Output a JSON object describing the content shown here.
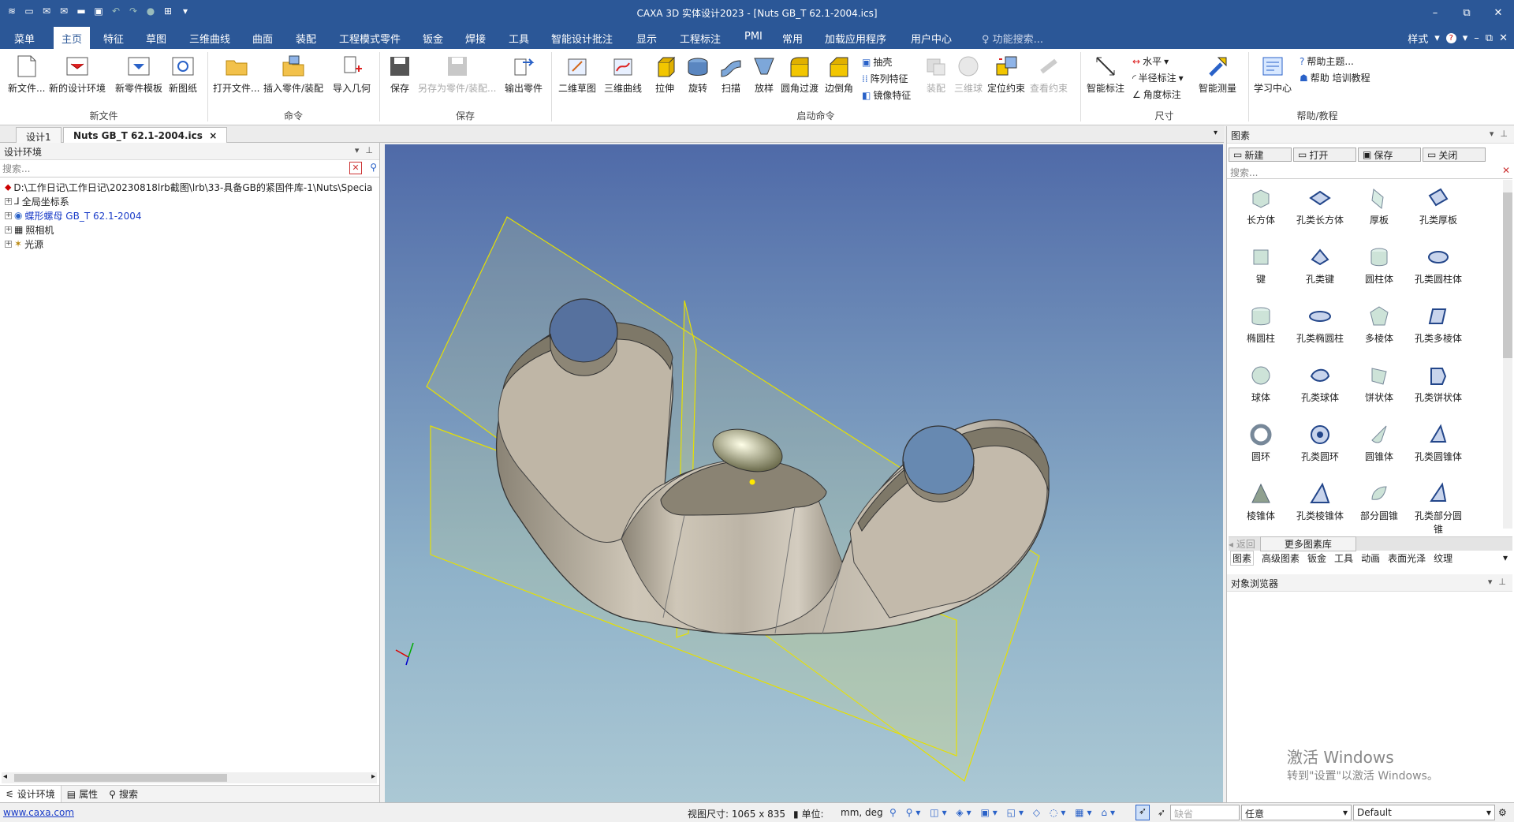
{
  "window": {
    "title": "CAXA 3D 实体设计2023 - [Nuts GB_T  62.1-2004.ics]",
    "min": "–",
    "restore": "⧉",
    "close": "✕"
  },
  "menubar": {
    "tabs": [
      "菜单",
      "主页",
      "特征",
      "草图",
      "三维曲线",
      "曲面",
      "装配",
      "工程模式零件",
      "钣金",
      "焊接",
      "工具",
      "智能设计批注",
      "显示",
      "工程标注",
      "PMI",
      "常用",
      "加载应用程序",
      "用户中心"
    ],
    "active": "主页",
    "search": "功能搜索...",
    "style": "样式"
  },
  "ribbon": {
    "new_file": {
      "buttons": [
        "新文件...",
        "新的设计环境",
        "新零件模板",
        "新图纸"
      ],
      "group": "新文件"
    },
    "command": {
      "buttons": [
        "打开文件...",
        "插入零件/装配",
        "导入几何"
      ],
      "group": "命令"
    },
    "save": {
      "buttons": [
        "保存",
        "另存为零件/装配...",
        "输出零件"
      ],
      "group": "保存"
    },
    "launch": {
      "buttons": [
        "二维草图",
        "三维曲线",
        "拉伸",
        "旋转",
        "扫描",
        "放样",
        "圆角过渡",
        "边倒角"
      ],
      "small": [
        "抽壳",
        "阵列特征",
        "镜像特征"
      ],
      "disabled": [
        "装配",
        "三维球"
      ],
      "more": [
        "定位约束",
        "查看约束"
      ],
      "group": "启动命令"
    },
    "dimension": {
      "smart": "智能标注",
      "small": [
        "水平",
        "半径标注",
        "角度标注"
      ],
      "measure": "智能测量",
      "group": "尺寸"
    },
    "help": {
      "center": "学习中心",
      "small": [
        "帮助主题...",
        "帮助 培训教程"
      ],
      "group": "帮助/教程"
    }
  },
  "doctabs": [
    "设计1",
    "Nuts GB_T  62.1-2004.ics"
  ],
  "left": {
    "title": "设计环境",
    "search": "搜索...",
    "tree": [
      {
        "label": "D:\\工作日记\\工作日记\\20230818lrb截图\\lrb\\33-具备GB的紧固件库-1\\Nuts\\Specia",
        "color": "#000"
      },
      {
        "label": "全局坐标系",
        "color": "#000"
      },
      {
        "label": "蝶形螺母 GB_T  62.1-2004",
        "color": "#1a3cc8"
      },
      {
        "label": "照相机",
        "color": "#000"
      },
      {
        "label": "光源",
        "color": "#000"
      }
    ],
    "tabs": [
      "设计环境",
      "属性",
      "搜索"
    ]
  },
  "right": {
    "title": "图素",
    "buttons": [
      "新建",
      "打开",
      "保存",
      "关闭"
    ],
    "search": "搜索...",
    "items": [
      "长方体",
      "孔类长方体",
      "厚板",
      "孔类厚板",
      "键",
      "孔类键",
      "圆柱体",
      "孔类圆柱体",
      "椭圆柱",
      "孔类椭圆柱",
      "多棱体",
      "孔类多棱体",
      "球体",
      "孔类球体",
      "饼状体",
      "孔类饼状体",
      "圆环",
      "孔类圆环",
      "圆锥体",
      "孔类圆锥体",
      "棱锥体",
      "孔类棱锥体",
      "部分圆锥",
      "孔类部分圆锥"
    ],
    "back": "返回",
    "more": "更多图素库",
    "tabs": [
      "图素",
      "高级图素",
      "钣金",
      "工具",
      "动画",
      "表面光泽",
      "纹理"
    ],
    "browser": "对象浏览器"
  },
  "status": {
    "link": "www.caxa.com",
    "view_size": "视图尺寸: 1065 x  835",
    "unit_label": "单位:",
    "unit": "mm, deg",
    "snap": "缺省",
    "filter": "任意",
    "style": "Default"
  },
  "watermark": {
    "line1": "激活 Windows",
    "line2": "转到\"设置\"以激活 Windows。"
  }
}
